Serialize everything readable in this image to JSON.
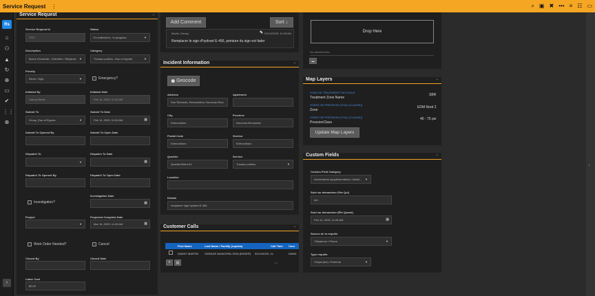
{
  "topbar": {
    "title": "Service Request",
    "menu": "⋮",
    "icons": [
      "search-icon",
      "save-icon",
      "close-icon",
      "more-icon",
      "filter-icon",
      "filter-alt-icon",
      "map-icon"
    ],
    "icon_glyphs": [
      "⌕",
      "▣",
      "✖",
      "•••",
      "≡",
      "☷",
      "▭"
    ],
    "accent": "#f5a623"
  },
  "leftnav": {
    "logo": "Rs",
    "icons": [
      "⌂",
      "⚇",
      "▲",
      "↻",
      "⊕",
      "▭",
      "✔",
      "⋮⋮",
      "⊗"
    ],
    "collapse": "›"
  },
  "service_request": {
    "title": "Service Request",
    "caret": "⌄",
    "fields": {
      "request_id_label": "Service Request Id",
      "request_id": "7977",
      "status_label": "Status",
      "status": "En traitement - In progress",
      "description_label": "Description",
      "description": "Borne d'incendie - Entretien / Réparati...",
      "category_label": "Category",
      "category": "Travaux publics - Eau et égoûts",
      "priority_label": "Priority",
      "priority": "Élevé / High",
      "emergency_label": "Emergency?",
      "initiated_by_label": "Initiated By",
      "initiated_by": "Danny Martin",
      "initiated_date_label": "Initiated Date",
      "initiated_date": "Feb 14, 2025, 11:28 AM",
      "submit_to_label": "Submit To",
      "submit_to": "Group_Eau et Égouts",
      "submit_to_date_label": "Submit To Date",
      "submit_to_date": "Feb 14, 2025, 11:28 AM",
      "submit_opened_by_label": "Submit To Opened By",
      "submit_open_date_label": "Submit To Open Date",
      "dispatch_to_label": "Dispatch To",
      "dispatch_to_date_label": "Dispatch To Date",
      "dispatch_opened_by_label": "Dispatch To Opened By",
      "dispatch_open_date_label": "Dispatch To Open Date",
      "investigation_label": "Investigation?",
      "investigation_date_label": "Investigation Date",
      "project_label": "Project",
      "projected_complete_label": "Projected Complete Date",
      "projected_complete": "Mar 16, 2025, 11:28 AM",
      "work_order_label": "Work Order Needed?",
      "cancel_label": "Cancel",
      "closed_by_label": "Closed By",
      "closed_date_label": "Closed Date",
      "labor_cost_label": "Labor Cost",
      "labor_cost": "$0.00"
    }
  },
  "comments": {
    "add_button": "Add Comment",
    "sort_button": "Sort",
    "sort_glyph": "↓",
    "author": "Martin, Danny",
    "date": "02/14/2025, 11:28 AM",
    "edit_glyph": "✎",
    "text": "Remplacer le sign d'hydrant E-456, peinture du sign est fader"
  },
  "incident": {
    "title": "Incident Information",
    "caret": "⌄",
    "geocode_button": "Geocode",
    "pin_glyph": "⬤",
    "address_label": "Address",
    "address": "Rue Richards, Edmundston, Nouveau Brun",
    "apartment_label": "Apartment",
    "city_label": "City",
    "city": "Edmundston",
    "province_label": "Province",
    "province": "Nouveau-Brunswick",
    "postal_label": "Postal Code",
    "postal": "Edmundston",
    "sector_label": "Secteur",
    "sector": "Edmundston",
    "quarter_label": "Quartier",
    "quarter": "Quartier/Ward #1",
    "service_label": "Service",
    "service": "Travaux publics",
    "location_label": "Location",
    "details_label": "Details",
    "details": "remplacer sign hydrant E-456"
  },
  "customer_calls": {
    "title": "Customer Calls",
    "caret": "⌄",
    "columns": [
      "First Name",
      "Last Name / Facility (repeats)",
      "Call Time",
      "Com"
    ],
    "rows": [
      {
        "first": "DANNY MARTIN",
        "last": "GARAGE MUNICIPAL EDM (ENVER)",
        "time": "02/14/2025, 11:",
        "com": "DANN"
      }
    ],
    "pager": "1 ▸"
  },
  "attachments": {
    "drop_here": "Drop Here",
    "none": "No attachments...",
    "add_glyph": "▬"
  },
  "map_layers": {
    "title": "Map Layers",
    "caret": "⌄",
    "items": [
      {
        "link": "ZONE DE TRAITEMENT DES EAUX",
        "name": "Treatment Zone Name",
        "value": "SBR"
      },
      {
        "link": "ZONES DE PRESSION (TEAU (CLASSE))",
        "name": "Zone",
        "value": "EDM Nord 2"
      },
      {
        "link": "ZONES DE PRESSION (TEAU (CLASSE))",
        "name": "PressionClass",
        "value": "46 - 75 psi"
      }
    ],
    "update_button": "Update Map Layers"
  },
  "custom_fields": {
    "title": "Custom Fields",
    "caret": "⌄",
    "group_label": "Custom Field Category",
    "group": "Informations supplémentaires / Additi...",
    "followup_label": "Suivi au demandeur (Par Qui)",
    "followup": "dm",
    "followup_date_label": "Suivi au demandeur (Été Quand)",
    "followup_date": "Feb 14, 2025, 11:28 AM",
    "source_label": "Source de la requête",
    "source": "Téléphone / Phone",
    "type_label": "Type requête",
    "type": "Citoyen(ne) / External"
  },
  "gutter": {
    "text": "ℹ"
  }
}
